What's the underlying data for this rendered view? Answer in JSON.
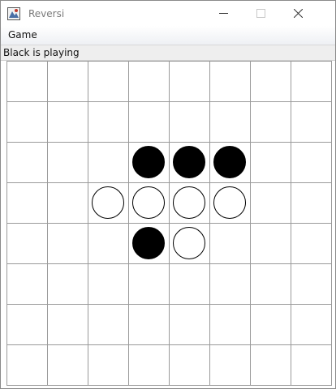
{
  "window": {
    "title": "Reversi",
    "controls": [
      "minimize",
      "maximize",
      "close"
    ]
  },
  "menubar": {
    "items": [
      {
        "label": "Game"
      }
    ]
  },
  "status": {
    "text": "Black is playing"
  },
  "board": {
    "size": 8,
    "pieces": [
      {
        "row": 2,
        "col": 3,
        "color": "black"
      },
      {
        "row": 2,
        "col": 4,
        "color": "black"
      },
      {
        "row": 2,
        "col": 5,
        "color": "black"
      },
      {
        "row": 3,
        "col": 2,
        "color": "white"
      },
      {
        "row": 3,
        "col": 3,
        "color": "white"
      },
      {
        "row": 3,
        "col": 4,
        "color": "white"
      },
      {
        "row": 3,
        "col": 5,
        "color": "white"
      },
      {
        "row": 4,
        "col": 3,
        "color": "black"
      },
      {
        "row": 4,
        "col": 4,
        "color": "white"
      }
    ]
  },
  "colors": {
    "black_piece": "#000000",
    "white_piece": "#ffffff",
    "grid_line": "#9a9a9a"
  },
  "icons": {
    "app": "reversi-app-icon",
    "minimize": "minimize-icon",
    "maximize": "maximize-icon",
    "close": "close-icon"
  }
}
